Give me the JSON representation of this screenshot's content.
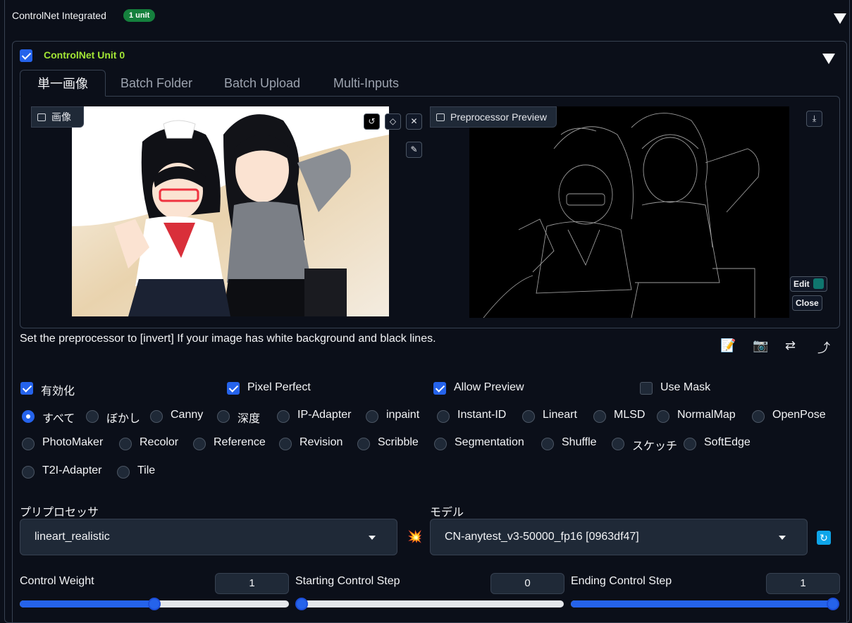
{
  "header": {
    "title": "ControlNet Integrated",
    "badge": "1 unit"
  },
  "unit": {
    "title": "ControlNet Unit 0",
    "enabled": true
  },
  "tabs": [
    "単一画像",
    "Batch Folder",
    "Batch Upload",
    "Multi-Inputs"
  ],
  "image_panel": {
    "label": "画像"
  },
  "preview_panel": {
    "label": "Preprocessor Preview",
    "edit_label": "Edit",
    "close_label": "Close"
  },
  "hint": "Set the preprocessor to [invert] If your image has white background and black lines.",
  "tool_icons": [
    "memo-icon",
    "camera-icon",
    "swap-icon",
    "curved-arrow-icon"
  ],
  "options": [
    {
      "label": "有効化",
      "checked": true
    },
    {
      "label": "Pixel Perfect",
      "checked": true
    },
    {
      "label": "Allow Preview",
      "checked": true
    },
    {
      "label": "Use Mask",
      "checked": false
    }
  ],
  "control_types": {
    "selected": "すべて",
    "items": [
      "すべて",
      "ぼかし",
      "Canny",
      "深度",
      "IP-Adapter",
      "inpaint",
      "Instant-ID",
      "Lineart",
      "MLSD",
      "NormalMap",
      "OpenPose",
      "PhotoMaker",
      "Recolor",
      "Reference",
      "Revision",
      "Scribble",
      "Segmentation",
      "Shuffle",
      "スケッチ",
      "SoftEdge",
      "T2I-Adapter",
      "Tile"
    ]
  },
  "preprocessor": {
    "label": "プリプロセッサ",
    "value": "lineart_realistic"
  },
  "model": {
    "label": "モデル",
    "value": "CN-anytest_v3-50000_fp16 [0963df47]"
  },
  "sliders": [
    {
      "label": "Control Weight",
      "value": "1",
      "fraction": 0.5
    },
    {
      "label": "Starting Control Step",
      "value": "0",
      "fraction": 0.0
    },
    {
      "label": "Ending Control Step",
      "value": "1",
      "fraction": 1.0
    }
  ],
  "colors": {
    "accent": "#2563eb",
    "unit_title": "#a3e635",
    "badge": "#15803d",
    "background": "#0b0f19"
  }
}
